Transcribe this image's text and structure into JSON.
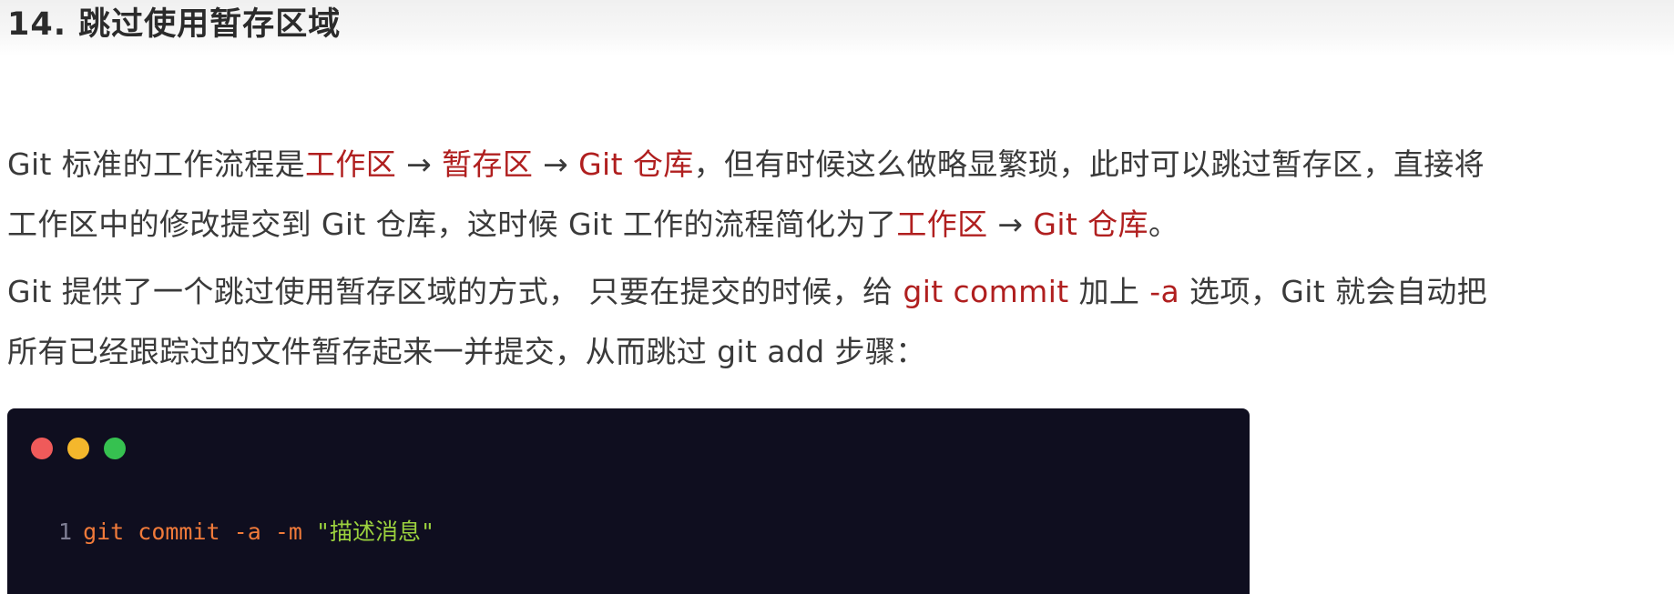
{
  "heading": "14. 跳过使用暂存区域",
  "paragraph1": {
    "line1": {
      "t1": "Git 标准的工作流程是",
      "h1": "工作区",
      "t2": " → ",
      "h2": "暂存区",
      "t3": " → ",
      "h3": "Git 仓库",
      "t4": "，但有时候这么做略显繁琐，此时可以跳过暂存区，直接将"
    },
    "line2": {
      "t1": "工作区中的修改提交到 Git 仓库，这时候 Git 工作的流程简化为了",
      "h1": "工作区",
      "t2": " → ",
      "h2": "Git 仓库",
      "t3": "。"
    }
  },
  "paragraph2": {
    "line1": {
      "t1": "Git 提供了一个跳过使用暂存区域的方式， 只要在提交的时候，给 ",
      "h1": "git commit",
      "t2": " 加上 ",
      "h2": "-a",
      "t3": " 选项，Git 就会自动把"
    },
    "line2": {
      "t1": "所有已经跟踪过的文件暂存起来一并提交，从而跳过 git add 步骤："
    }
  },
  "code_block": {
    "line_number": "1",
    "cmd": "git",
    "sub": "commit",
    "flag_a": "-a",
    "flag_m": "-m",
    "message": "\"描述消息\"",
    "colors": {
      "background": "#0f0e1f",
      "keyword": "#f07a3a",
      "string": "#9bd13e",
      "line_number": "#7e7e94"
    }
  },
  "colors": {
    "highlight": "#b01f1f",
    "text": "#3a3a3a"
  }
}
